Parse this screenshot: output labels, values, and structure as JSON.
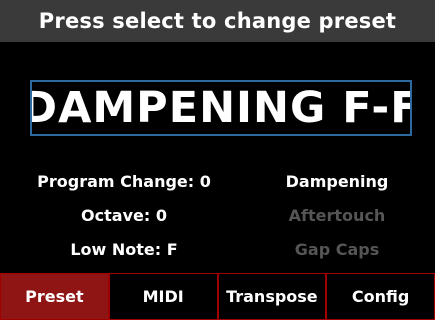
{
  "header": {
    "title": "Press select to change preset"
  },
  "preset": {
    "name": "DAMPENING F-F"
  },
  "info": {
    "left": [
      {
        "text": "Program Change: 0",
        "dim": false
      },
      {
        "text": "Octave: 0",
        "dim": false
      },
      {
        "text": "Low Note: F",
        "dim": false
      }
    ],
    "right": [
      {
        "text": "Dampening",
        "dim": false
      },
      {
        "text": "Aftertouch",
        "dim": true
      },
      {
        "text": "Gap Caps",
        "dim": true
      }
    ]
  },
  "tabs": [
    {
      "label": "Preset",
      "active": true
    },
    {
      "label": "MIDI",
      "active": false
    },
    {
      "label": "Transpose",
      "active": false
    },
    {
      "label": "Config",
      "active": false
    }
  ],
  "colors": {
    "header_bg": "#3a3a3a",
    "preset_border": "#2c6aa0",
    "active_tab": "#8f1414",
    "tab_border": "#a10000",
    "dim_text": "#555555"
  }
}
